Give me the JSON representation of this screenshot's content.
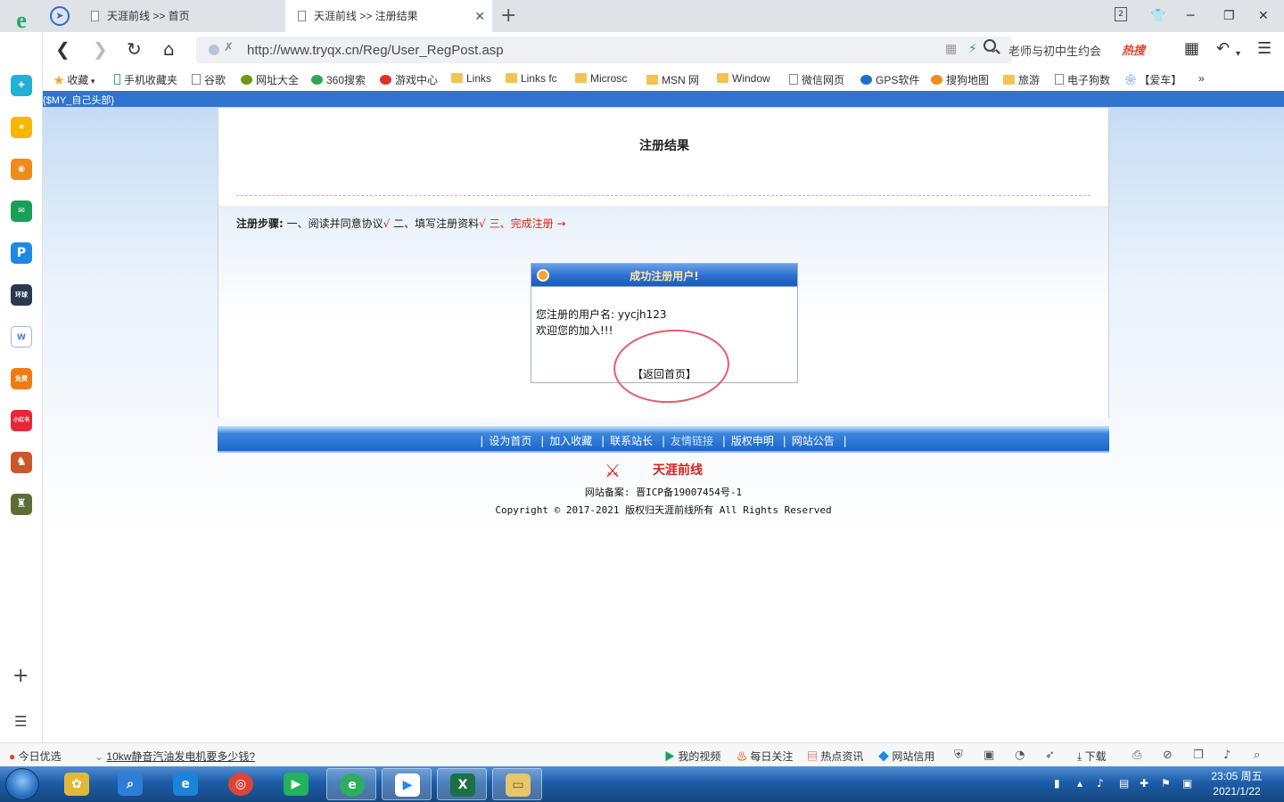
{
  "browser": {
    "tabs": [
      {
        "label": "天涯前线 >> 首页",
        "active": false
      },
      {
        "label": "天涯前线 >> 注册结果",
        "active": true
      }
    ],
    "tab_counter": "2",
    "url": "http://www.tryqx.cn/Reg/User_RegPost.asp",
    "search_text": "老师与初中生约会",
    "hot_search_label": "热搜"
  },
  "bookmarks": [
    {
      "label": "收藏",
      "icon": "star-icon",
      "color": "#f5a623"
    },
    {
      "label": "手机收藏夹",
      "icon": "phone-icon",
      "color": "#2fb36a"
    },
    {
      "label": "谷歌",
      "icon": "page-icon",
      "color": "#888888"
    },
    {
      "label": "网址大全",
      "icon": "globe-icon",
      "color": "#6a9a10"
    },
    {
      "label": "360搜索",
      "icon": "search-360-icon",
      "color": "#2fa84f"
    },
    {
      "label": "游戏中心",
      "icon": "game-icon",
      "color": "#d9312b"
    },
    {
      "label": "Links",
      "icon": "folder-icon",
      "color": "#f4c253"
    },
    {
      "label": "Links fc",
      "icon": "folder-icon",
      "color": "#f4c253"
    },
    {
      "label": "Microsc",
      "icon": "folder-icon",
      "color": "#f4c253"
    },
    {
      "label": "MSN 网",
      "icon": "folder-icon",
      "color": "#f4c253"
    },
    {
      "label": "Window",
      "icon": "folder-icon",
      "color": "#f4c253"
    },
    {
      "label": "微信网页",
      "icon": "page-icon",
      "color": "#888888"
    },
    {
      "label": "GPS软件",
      "icon": "gps-icon",
      "color": "#1f6fd1"
    },
    {
      "label": "搜狗地图",
      "icon": "sogou-icon",
      "color": "#f08c1d"
    },
    {
      "label": "旅游",
      "icon": "folder-icon",
      "color": "#f4c253"
    },
    {
      "label": "电子狗数",
      "icon": "page-icon",
      "color": "#888888"
    },
    {
      "label": "【爱车】",
      "icon": "paw-icon",
      "color": "#2a6bd8"
    }
  ],
  "bookmarks_more": "»",
  "sidebar": [
    {
      "name": "sidebar-plus-app-icon",
      "color": "#22b0d6",
      "glyph": "✚"
    },
    {
      "name": "sidebar-star-icon",
      "color": "#f5b800",
      "glyph": "★"
    },
    {
      "name": "sidebar-weibo-icon",
      "color": "#f08a1d",
      "glyph": "◉"
    },
    {
      "name": "sidebar-mail-icon",
      "color": "#18a058",
      "glyph": "✉"
    },
    {
      "name": "sidebar-ip-icon",
      "color": "#1e88e5",
      "glyph": "P"
    },
    {
      "name": "sidebar-news-icon",
      "color": "#2b3950",
      "glyph": "环球"
    },
    {
      "name": "sidebar-doc-icon",
      "color": "#4a7fd6",
      "glyph": "W"
    },
    {
      "name": "sidebar-novel-icon",
      "color": "#f07b12",
      "glyph": "免费"
    },
    {
      "name": "sidebar-xiaohongshu-icon",
      "color": "#e8263a",
      "glyph": "小红书"
    },
    {
      "name": "sidebar-game1-icon",
      "color": "#c9582a",
      "glyph": "♞"
    },
    {
      "name": "sidebar-game2-icon",
      "color": "#5a6e36",
      "glyph": "♜"
    }
  ],
  "page": {
    "header_placeholder": "{$MY_自己头部}",
    "title": "注册结果",
    "steps": {
      "label": "注册步骤:",
      "step1": "一、阅读并同意协议",
      "step2": "二、填写注册资料",
      "step3": "三、完成注册",
      "check": "√",
      "arrow": "→"
    },
    "result_box": {
      "title": "成功注册用户!",
      "username_line": "您注册的用户名: yycjh123",
      "welcome_line": "欢迎您的加入!!!",
      "back_link": "【返回首页】"
    },
    "footer_links": [
      "设为首页",
      "加入收藏",
      "联系站长",
      "友情链接",
      "版权申明",
      "网站公告"
    ],
    "brand_name": "天涯前线",
    "icp": "网站备案: 晋ICP备19007454号-1",
    "copyright": "Copyright © 2017-2021 版权归天涯前线所有 All Rights Reserved"
  },
  "statusbar": {
    "today_pick": "今日优选",
    "news_link": "10kw静音汽油发电机要多少钱?",
    "right_items": [
      "我的视频",
      "每日关注",
      "热点资讯",
      "网站信用"
    ],
    "download": "下载"
  },
  "taskbar": {
    "time": "23:05 周五",
    "date": "2021/1/22"
  },
  "colors": {
    "accent_blue": "#2f74cf",
    "step_red": "#e0201b",
    "brand_red": "#d2231f"
  }
}
